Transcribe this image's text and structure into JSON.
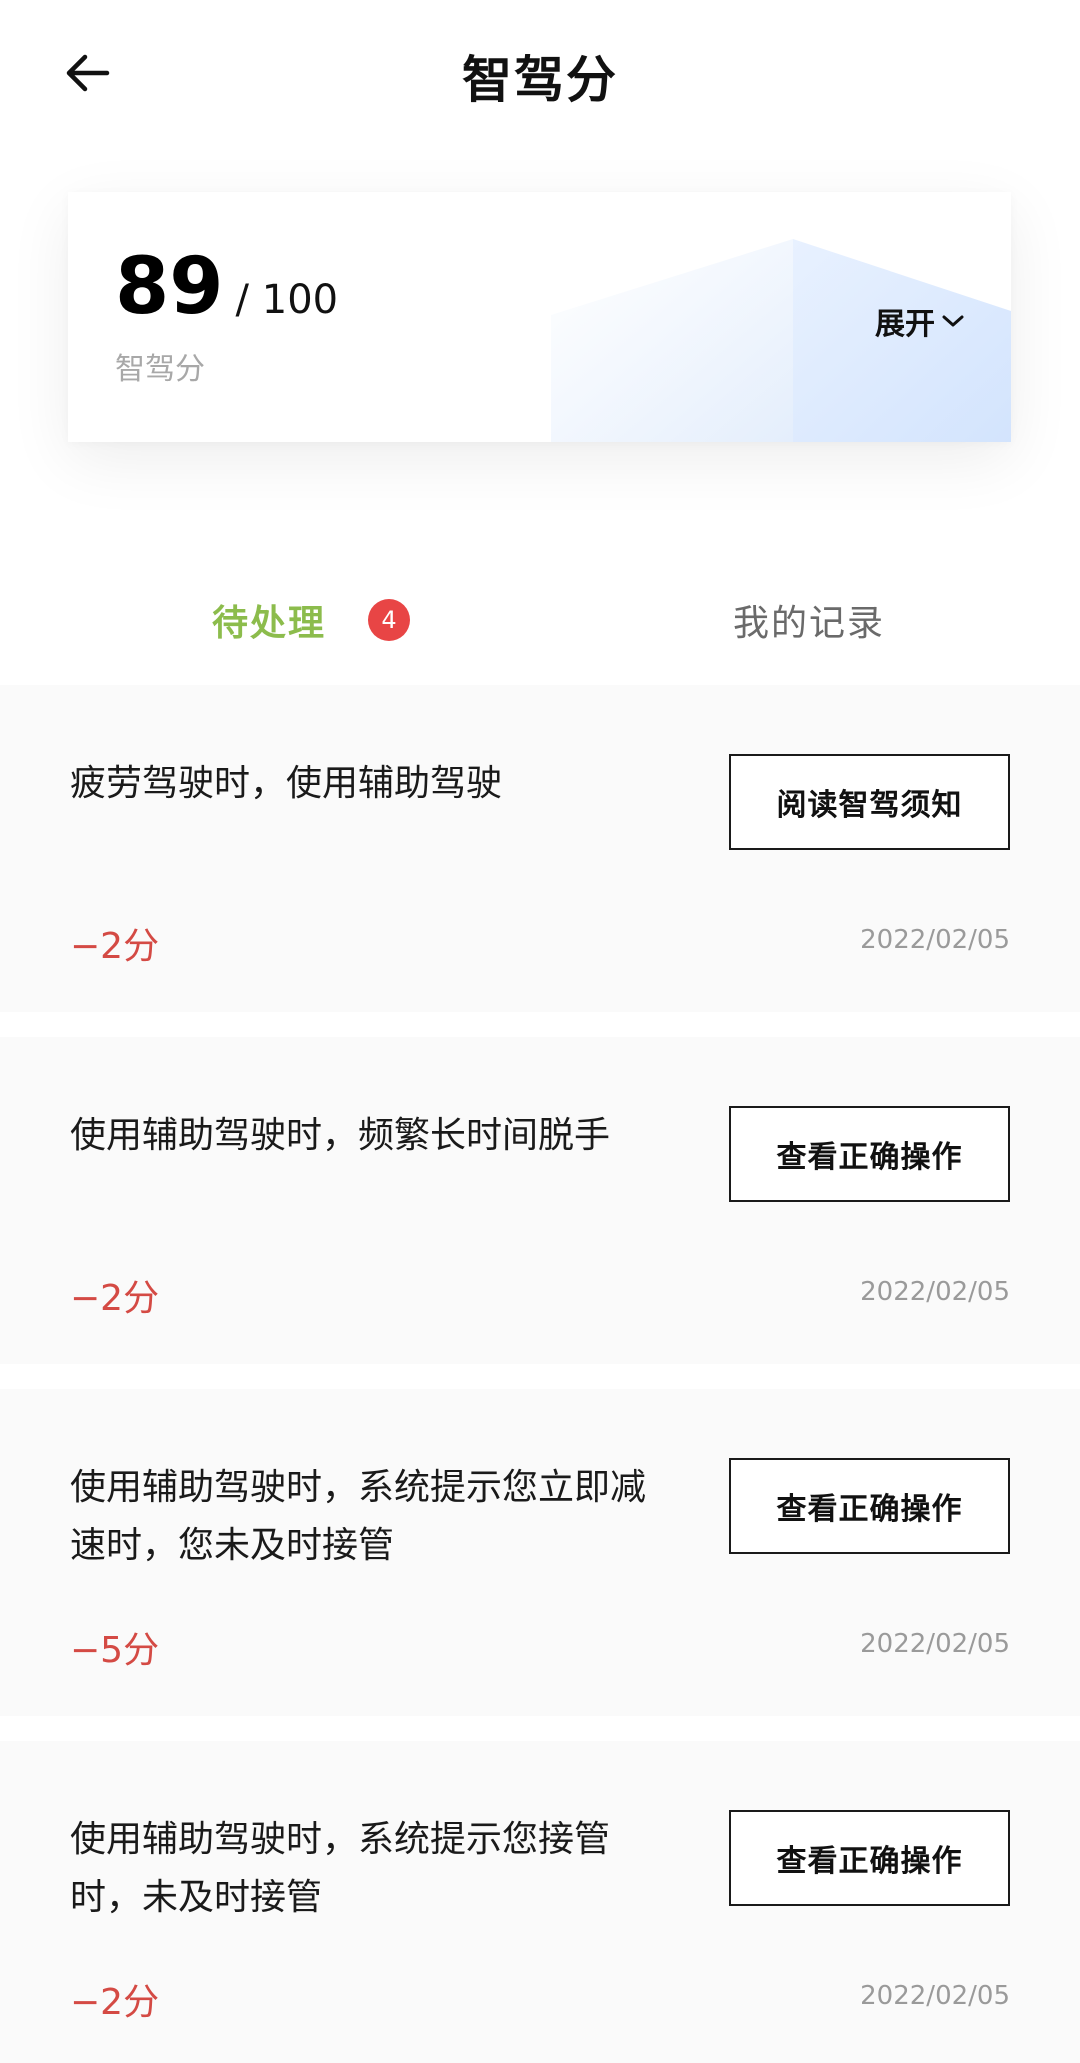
{
  "header": {
    "title": "智驾分",
    "back_icon": "arrow-left-icon"
  },
  "score_card": {
    "score": "89",
    "total": "/ 100",
    "label": "智驾分",
    "expand_label": "展开",
    "expand_icon": "chevron-down-icon",
    "accent_color": "#d8e8ff"
  },
  "tabs": [
    {
      "label": "待处理",
      "badge": "4",
      "active": true,
      "color": "#8cbc4c"
    },
    {
      "label": "我的记录",
      "active": false
    }
  ],
  "items": [
    {
      "text": "疲劳驾驶时，使用辅助驾驶",
      "action": "阅读智驾须知",
      "points": "−2分",
      "date": "2022/02/05"
    },
    {
      "text": "使用辅助驾驶时，频繁长时间脱手",
      "action": "查看正确操作",
      "points": "−2分",
      "date": "2022/02/05"
    },
    {
      "text": "使用辅助驾驶时，系统提示您立即减速时，您未及时接管",
      "action": "查看正确操作",
      "points": "−5分",
      "date": "2022/02/05"
    },
    {
      "text": "使用辅助驾驶时，系统提示您接管时，未及时接管",
      "action": "查看正确操作",
      "points": "−2分",
      "date": "2022/02/05"
    }
  ],
  "colors": {
    "badge": "#e84545",
    "points": "#d44a44",
    "item_bg": "#fafafa"
  }
}
